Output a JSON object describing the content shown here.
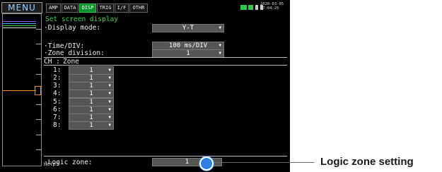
{
  "menu": {
    "label": "MENU"
  },
  "tabs": [
    "AMP",
    "DATA",
    "DISP",
    "TRIG",
    "I/F",
    "OTHR"
  ],
  "active_tab": "DISP",
  "status": {
    "date": "2020-03-05",
    "time": "07:04:25"
  },
  "settings": {
    "title": "Set screen display",
    "display_mode": {
      "label": "·Display mode:",
      "value": "Y-T"
    },
    "time_div": {
      "label": "·Time/DIV:",
      "value": "100 ms/DIV"
    },
    "zone_division": {
      "label": "·Zone division:",
      "value": "1"
    },
    "table_header": {
      "ch": "CH :",
      "zone": "Zone"
    },
    "channels": [
      {
        "ch": "1:",
        "zone": "1"
      },
      {
        "ch": "2:",
        "zone": "1"
      },
      {
        "ch": "3:",
        "zone": "1"
      },
      {
        "ch": "4:",
        "zone": "1"
      },
      {
        "ch": "5:",
        "zone": "1"
      },
      {
        "ch": "6:",
        "zone": "1"
      },
      {
        "ch": "7:",
        "zone": "1"
      },
      {
        "ch": "8:",
        "zone": "1"
      }
    ],
    "logic_zone": {
      "label": "·Logic zone:",
      "value": "1"
    }
  },
  "help": "Help?",
  "callout": "Logic zone setting",
  "colors": {
    "accent_green": "#3ad24f",
    "tab_active": "#0a8f2a",
    "callout_blue": "#2f7fe2"
  },
  "icons": [
    "battery-icon",
    "network-icon",
    "card-icon",
    "usb-icon"
  ]
}
